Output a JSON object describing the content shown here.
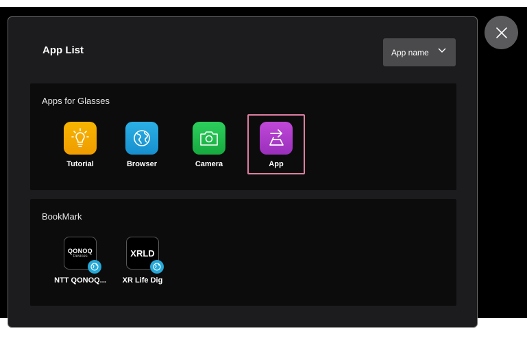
{
  "dialog": {
    "title": "App List",
    "sort": {
      "label": "App name"
    }
  },
  "apps_section": {
    "title": "Apps for Glasses",
    "items": [
      {
        "label": "Tutorial",
        "icon": "lightbulb-icon",
        "color": "#f2a900"
      },
      {
        "label": "Browser",
        "icon": "globe-icon",
        "color": "#1f9fd6"
      },
      {
        "label": "Camera",
        "icon": "camera-icon",
        "color": "#1fbd4c"
      },
      {
        "label": "App",
        "icon": "app-arrow-icon",
        "color": "#b03cc9",
        "selected": true
      }
    ]
  },
  "bookmark_section": {
    "title": "BookMark",
    "items": [
      {
        "label": "NTT QONOQ...",
        "logo_text": "QONOQ",
        "logo_subtext": "Devices"
      },
      {
        "label": "XR Life Dig",
        "logo_text": "XRLD"
      }
    ]
  },
  "colors": {
    "selection_border": "#e07ea3",
    "globe_badge": "#25a8d8"
  }
}
